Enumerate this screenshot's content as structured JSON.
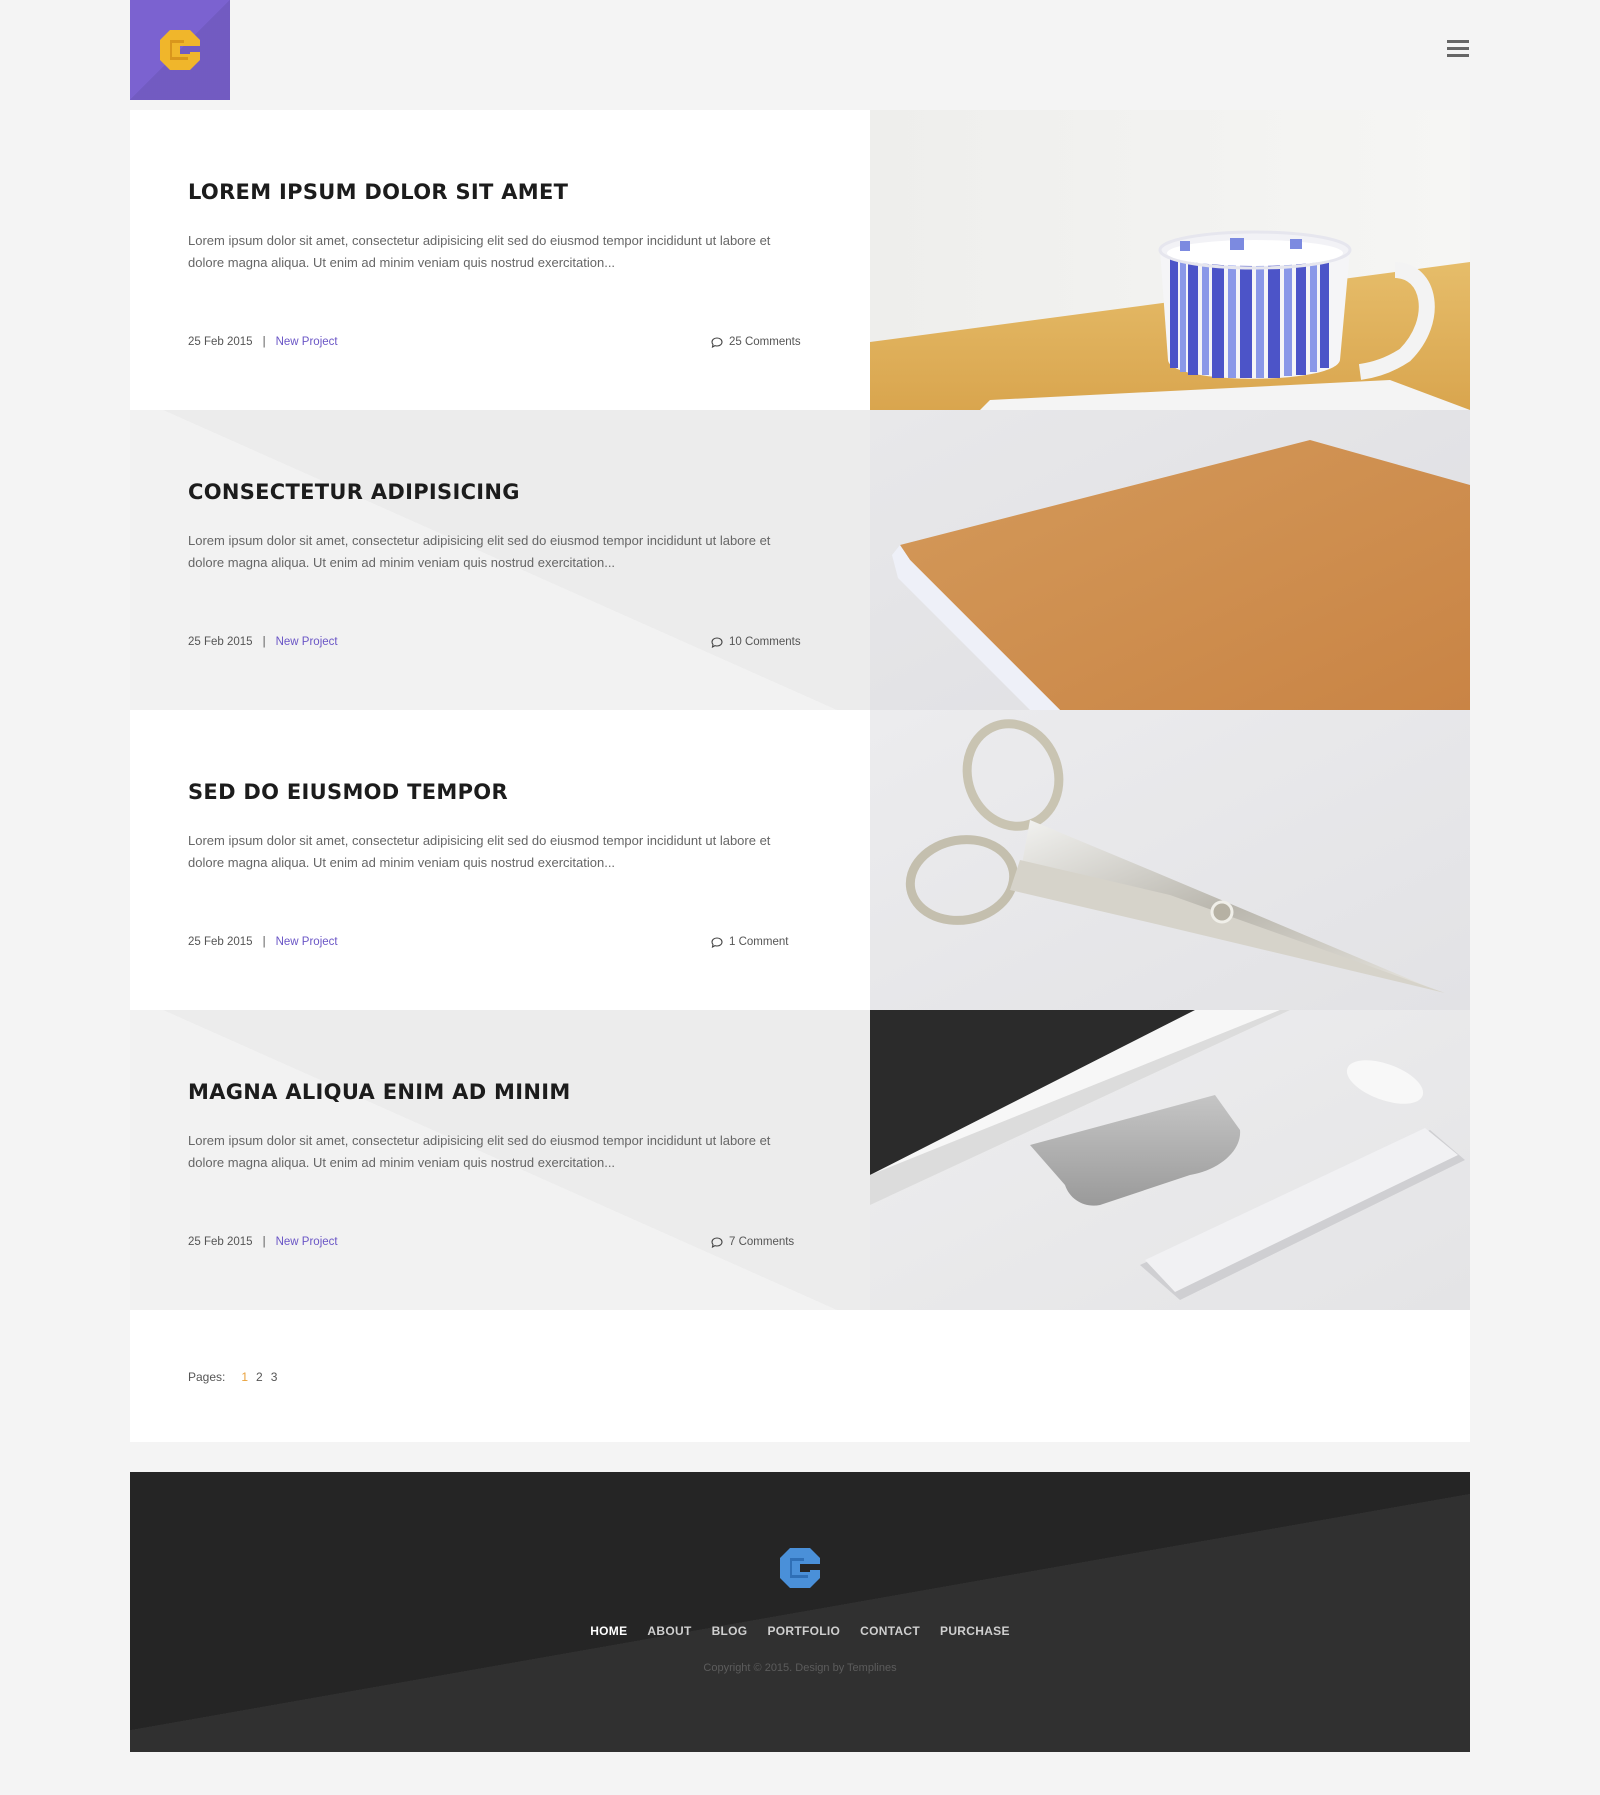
{
  "header": {
    "logo_icon": "g-logo-icon",
    "menu_icon": "hamburger-menu-icon"
  },
  "posts": [
    {
      "title": "LOREM IPSUM DOLOR SIT AMET",
      "excerpt": "Lorem ipsum dolor sit amet, consectetur adipisicing elit sed do eiusmod tempor incididunt ut labore et dolore magna aliqua. Ut enim ad minim veniam quis nostrud exercitation...",
      "date": "25 Feb 2015",
      "category": "New Project",
      "comments": "25 Comments",
      "image": "coffee-cup-photo"
    },
    {
      "title": "CONSECTETUR ADIPISICING",
      "excerpt": "Lorem ipsum dolor sit amet, consectetur adipisicing elit sed do eiusmod tempor incididunt ut labore et dolore magna aliqua. Ut enim ad minim veniam quis nostrud exercitation...",
      "date": "25 Feb 2015",
      "category": "New Project",
      "comments": "10 Comments",
      "image": "book-photo"
    },
    {
      "title": "SED DO EIUSMOD TEMPOR",
      "excerpt": "Lorem ipsum dolor sit amet, consectetur adipisicing elit sed do eiusmod tempor incididunt ut labore et dolore magna aliqua. Ut enim ad minim veniam quis nostrud exercitation...",
      "date": "25 Feb 2015",
      "category": "New Project",
      "comments": "1 Comment",
      "image": "scissors-photo"
    },
    {
      "title": "MAGNA ALIQUA ENIM AD MINIM",
      "excerpt": "Lorem ipsum dolor sit amet, consectetur adipisicing elit sed do eiusmod tempor incididunt ut labore et dolore magna aliqua. Ut enim ad minim veniam quis nostrud exercitation...",
      "date": "25 Feb 2015",
      "category": "New Project",
      "comments": "7 Comments",
      "image": "keyboard-photo"
    }
  ],
  "pagination": {
    "label": "Pages:",
    "pages": [
      "1",
      "2",
      "3"
    ],
    "current": "1"
  },
  "footer": {
    "nav": [
      "HOME",
      "ABOUT",
      "BLOG",
      "PORTFOLIO",
      "CONTACT",
      "PURCHASE"
    ],
    "active": "HOME",
    "copyright": "Copyright © 2015. Design by Templines"
  },
  "colors": {
    "accent_purple": "#7b62d0",
    "link_purple": "#6a55c6",
    "current_page": "#e9a13b",
    "footer_bg": "#252525",
    "logo_yellow": "#f0b62b",
    "footer_logo_blue": "#4a90d9"
  }
}
